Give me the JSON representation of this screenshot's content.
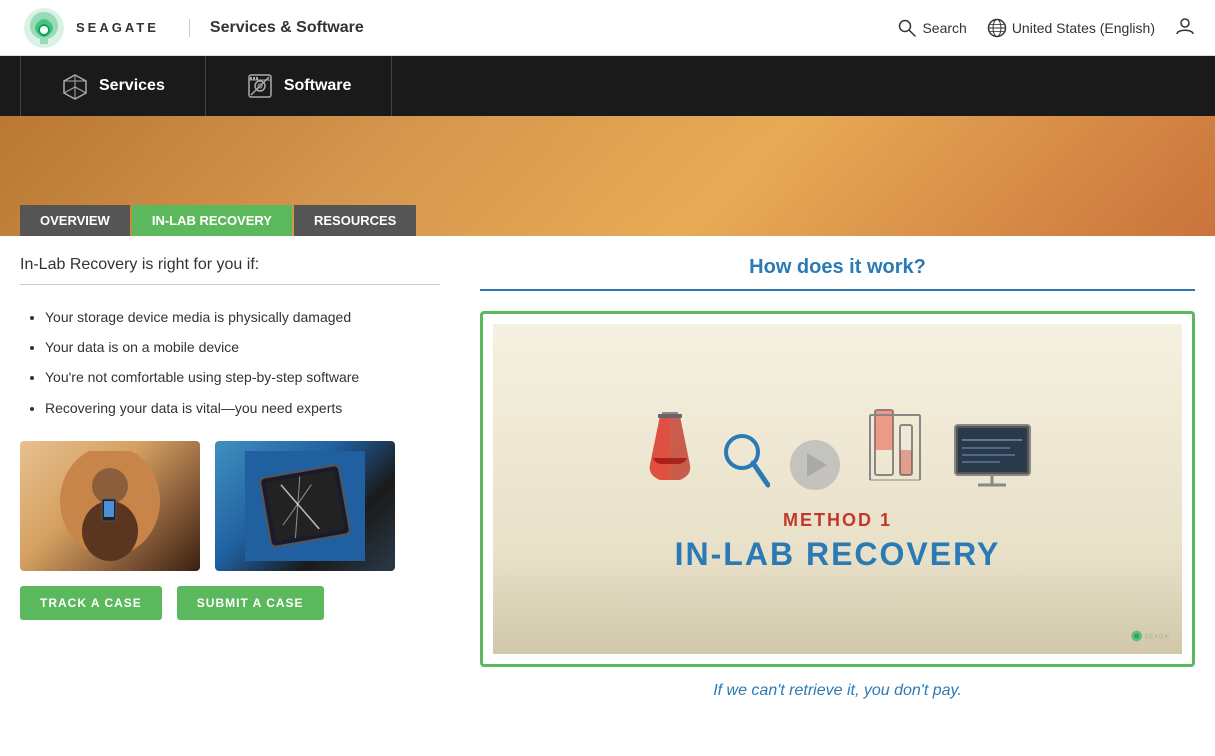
{
  "header": {
    "logo_text": "SEAGATE",
    "nav_title": "Services & Software",
    "search_label": "Search",
    "locale_label": "United States (English)"
  },
  "nav": {
    "items": [
      {
        "id": "services",
        "label": "Services",
        "icon": "cube-icon"
      },
      {
        "id": "software",
        "label": "Software",
        "icon": "disk-icon"
      }
    ]
  },
  "hero": {
    "tabs": [
      {
        "id": "overview",
        "label": "OVERVIEW",
        "active": false
      },
      {
        "id": "inlab",
        "label": "IN-LAB RECOVERY",
        "active": true
      },
      {
        "id": "resources",
        "label": "RESOURCES",
        "active": false
      }
    ]
  },
  "left_section": {
    "title": "In-Lab Recovery is right for you if:",
    "bullets": [
      "Your storage device media is physically damaged",
      "Your data is on a mobile device",
      "You're not comfortable using step-by-step software",
      "Recovering your data is vital—you need experts"
    ],
    "buttons": [
      {
        "id": "track",
        "label": "TRACK A CASE"
      },
      {
        "id": "submit",
        "label": "SUBMIT A CASE"
      }
    ]
  },
  "right_section": {
    "title": "How does it work?",
    "video": {
      "method_label": "METHOD 1",
      "recovery_label": "IN-LAB RECOVERY"
    },
    "tagline": "If we can't retrieve it, you don't pay."
  }
}
